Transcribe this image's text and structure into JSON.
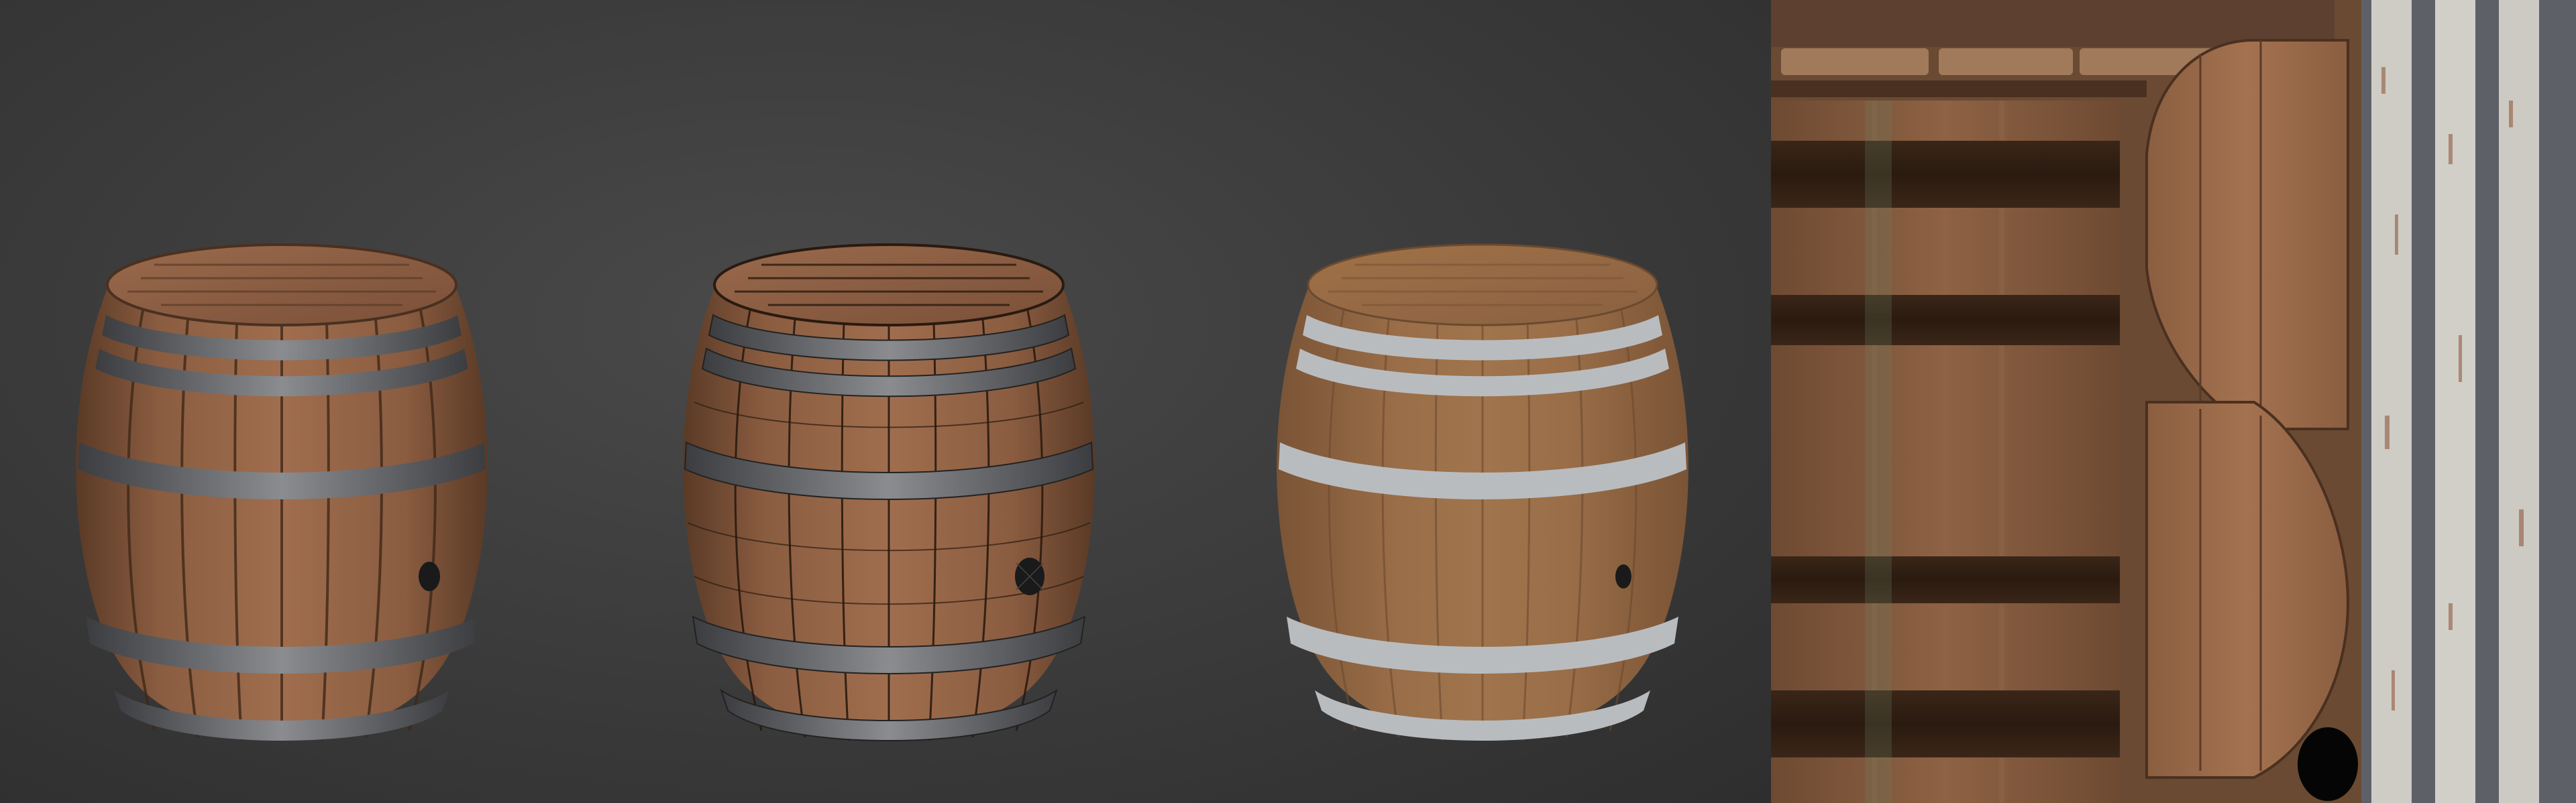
{
  "scene": {
    "views": [
      {
        "id": "pbr-shaded",
        "wireframe": false,
        "metal_color": "#7d7f84"
      },
      {
        "id": "wireframe-shaded",
        "wireframe": true,
        "metal_color": "#7d7f84"
      },
      {
        "id": "albedo-flat",
        "wireframe": false,
        "metal_color": "#b9bcbf"
      }
    ],
    "colors": {
      "background_center": "#4a4a4a",
      "background_edge": "#2e2e2e",
      "wood_light": "#a06e4e",
      "wood_mid": "#8a5c40",
      "wood_dark": "#5e3e2a",
      "metal": "#7d7f84",
      "metal_painted": "#b9bcbf",
      "texture_strip": "#d0cdc8"
    }
  }
}
